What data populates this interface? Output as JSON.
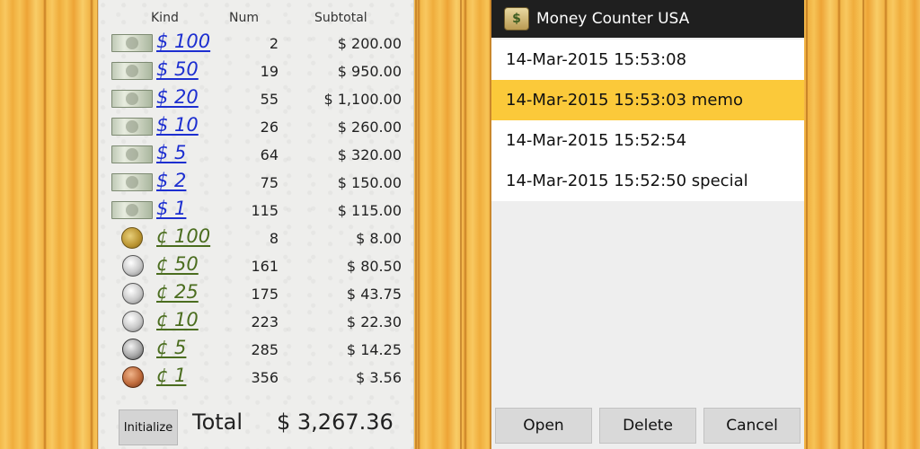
{
  "left": {
    "headers": {
      "kind": "Kind",
      "num": "Num",
      "subtotal": "Subtotal"
    },
    "rows": [
      {
        "kind": "$ 100",
        "num": "2",
        "subtotal": "$ 200.00",
        "type": "bill",
        "icon": "hundred-dollar-bill-icon"
      },
      {
        "kind": "$ 50",
        "num": "19",
        "subtotal": "$ 950.00",
        "type": "bill",
        "icon": "fifty-dollar-bill-icon"
      },
      {
        "kind": "$ 20",
        "num": "55",
        "subtotal": "$ 1,100.00",
        "type": "bill",
        "icon": "twenty-dollar-bill-icon"
      },
      {
        "kind": "$ 10",
        "num": "26",
        "subtotal": "$ 260.00",
        "type": "bill",
        "icon": "ten-dollar-bill-icon"
      },
      {
        "kind": "$ 5",
        "num": "64",
        "subtotal": "$ 320.00",
        "type": "bill",
        "icon": "five-dollar-bill-icon"
      },
      {
        "kind": "$ 2",
        "num": "75",
        "subtotal": "$ 150.00",
        "type": "bill",
        "icon": "two-dollar-bill-icon"
      },
      {
        "kind": "$ 1",
        "num": "115",
        "subtotal": "$ 115.00",
        "type": "bill",
        "icon": "one-dollar-bill-icon"
      },
      {
        "kind": "¢ 100",
        "num": "8",
        "subtotal": "$ 8.00",
        "type": "gold",
        "icon": "dollar-coin-icon"
      },
      {
        "kind": "¢ 50",
        "num": "161",
        "subtotal": "$ 80.50",
        "type": "silver",
        "icon": "half-dollar-coin-icon"
      },
      {
        "kind": "¢ 25",
        "num": "175",
        "subtotal": "$ 43.75",
        "type": "silver",
        "icon": "quarter-coin-icon"
      },
      {
        "kind": "¢ 10",
        "num": "223",
        "subtotal": "$ 22.30",
        "type": "silver",
        "icon": "dime-coin-icon"
      },
      {
        "kind": "¢ 5",
        "num": "285",
        "subtotal": "$ 14.25",
        "type": "nickel",
        "icon": "nickel-coin-icon"
      },
      {
        "kind": "¢ 1",
        "num": "356",
        "subtotal": "$ 3.56",
        "type": "copper",
        "icon": "penny-coin-icon"
      }
    ],
    "initialize_label": "Initialize",
    "total_label": "Total",
    "total_value": "$ 3,267.36"
  },
  "right": {
    "app_title": "Money Counter USA",
    "app_icon": "money-bag-icon",
    "items": [
      {
        "label": "14-Mar-2015 15:53:08",
        "selected": false
      },
      {
        "label": "14-Mar-2015 15:53:03 memo",
        "selected": true
      },
      {
        "label": "14-Mar-2015 15:52:54",
        "selected": false
      },
      {
        "label": "14-Mar-2015 15:52:50 special",
        "selected": false
      }
    ],
    "buttons": {
      "open": "Open",
      "delete": "Delete",
      "cancel": "Cancel"
    }
  },
  "colors": {
    "dollar_link": "#1d2fd0",
    "cent_link": "#4b6d1f",
    "selected_row": "#fbc93a",
    "title_bar": "#1f1f1f"
  }
}
